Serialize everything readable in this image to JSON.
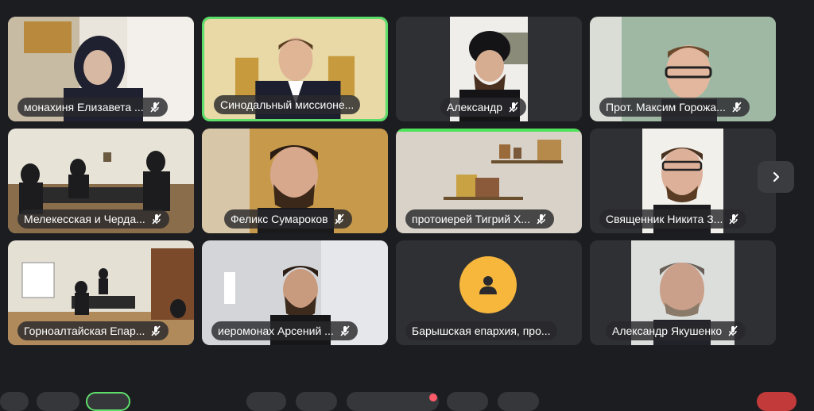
{
  "participants": [
    {
      "name": "монахиня Елизавета ..."
    },
    {
      "name": "Синодальный миссионе..."
    },
    {
      "name": "Александр"
    },
    {
      "name": "Прот. Максим Горожа..."
    },
    {
      "name": "Мелекесская и Черда..."
    },
    {
      "name": "Феликс Сумароков"
    },
    {
      "name": "протоиерей Тигрий Х..."
    },
    {
      "name": "Священник Никита З..."
    },
    {
      "name": "Горноалтайская Епар..."
    },
    {
      "name": "иеромонах Арсений ..."
    },
    {
      "name": "Барышская епархия, про..."
    },
    {
      "name": "Александр Якушенко"
    }
  ],
  "icons": {
    "muted": "mic-off-icon",
    "next": "chevron-right-icon",
    "avatar": "person-icon"
  },
  "colors": {
    "active_border": "#5dde6a",
    "avatar_bg": "#f6b73c",
    "background": "#1c1d20"
  }
}
